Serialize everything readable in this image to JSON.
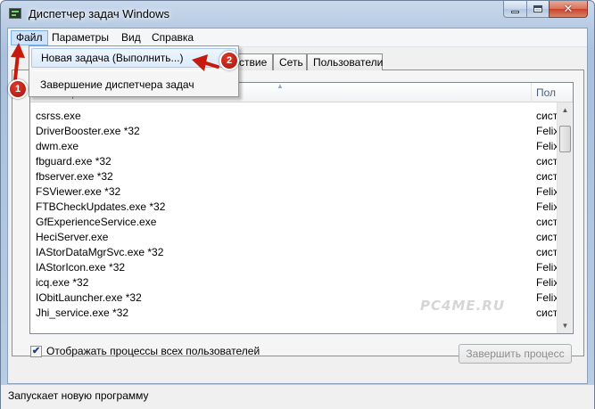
{
  "window": {
    "title": "Диспетчер задач Windows"
  },
  "caption_buttons": {
    "minimize": "minimize-icon",
    "maximize": "maximize-icon",
    "close": "close-icon"
  },
  "menubar": {
    "items": [
      "Файл",
      "Параметры",
      "Вид",
      "Справка"
    ]
  },
  "file_menu": {
    "items": [
      "Новая задача (Выполнить...)",
      "Завершение диспетчера задач"
    ]
  },
  "tabs": {
    "visible": [
      "ствие",
      "Сеть",
      "Пользователи"
    ]
  },
  "process_list": {
    "columns": [
      "Имя образа",
      "Пол"
    ],
    "rows": [
      {
        "name": "csrss.exe",
        "user": "сист"
      },
      {
        "name": "DriverBooster.exe *32",
        "user": "Felix"
      },
      {
        "name": "dwm.exe",
        "user": "Felix"
      },
      {
        "name": "fbguard.exe *32",
        "user": "сист"
      },
      {
        "name": "fbserver.exe *32",
        "user": "сист"
      },
      {
        "name": "FSViewer.exe *32",
        "user": "Felix"
      },
      {
        "name": "FTBCheckUpdates.exe *32",
        "user": "Felix"
      },
      {
        "name": "GfExperienceService.exe",
        "user": "сист"
      },
      {
        "name": "HeciServer.exe",
        "user": "сист"
      },
      {
        "name": "IAStorDataMgrSvc.exe *32",
        "user": "сист"
      },
      {
        "name": "IAStorIcon.exe *32",
        "user": "Felix"
      },
      {
        "name": "icq.exe *32",
        "user": "Felix"
      },
      {
        "name": "IObitLauncher.exe *32",
        "user": "Felix"
      },
      {
        "name": "Jhi_service.exe *32",
        "user": "сист"
      }
    ]
  },
  "watermark": "PC4ME.RU",
  "show_all_users": {
    "label": "Отображать процессы всех пользователей",
    "checked": true
  },
  "end_process_button": "Завершить процесс",
  "status_bar": {
    "text": "Запускает новую программу"
  },
  "annotations": {
    "badge_1": "1",
    "badge_2": "2",
    "color": "#c8190f"
  }
}
